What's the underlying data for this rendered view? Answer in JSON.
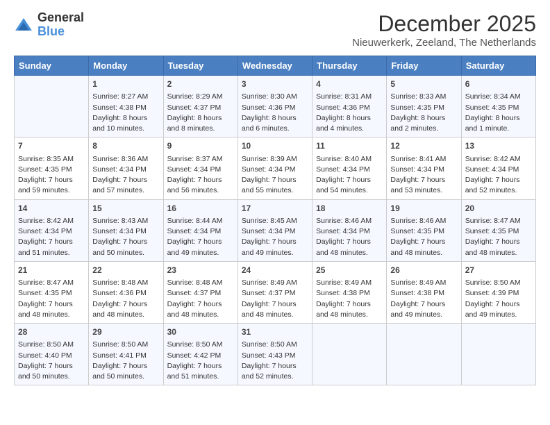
{
  "logo": {
    "general": "General",
    "blue": "Blue"
  },
  "title": "December 2025",
  "location": "Nieuwerkerk, Zeeland, The Netherlands",
  "weekdays": [
    "Sunday",
    "Monday",
    "Tuesday",
    "Wednesday",
    "Thursday",
    "Friday",
    "Saturday"
  ],
  "weeks": [
    [
      {
        "day": "",
        "info": ""
      },
      {
        "day": "1",
        "info": "Sunrise: 8:27 AM\nSunset: 4:38 PM\nDaylight: 8 hours\nand 10 minutes."
      },
      {
        "day": "2",
        "info": "Sunrise: 8:29 AM\nSunset: 4:37 PM\nDaylight: 8 hours\nand 8 minutes."
      },
      {
        "day": "3",
        "info": "Sunrise: 8:30 AM\nSunset: 4:36 PM\nDaylight: 8 hours\nand 6 minutes."
      },
      {
        "day": "4",
        "info": "Sunrise: 8:31 AM\nSunset: 4:36 PM\nDaylight: 8 hours\nand 4 minutes."
      },
      {
        "day": "5",
        "info": "Sunrise: 8:33 AM\nSunset: 4:35 PM\nDaylight: 8 hours\nand 2 minutes."
      },
      {
        "day": "6",
        "info": "Sunrise: 8:34 AM\nSunset: 4:35 PM\nDaylight: 8 hours\nand 1 minute."
      }
    ],
    [
      {
        "day": "7",
        "info": "Sunrise: 8:35 AM\nSunset: 4:35 PM\nDaylight: 7 hours\nand 59 minutes."
      },
      {
        "day": "8",
        "info": "Sunrise: 8:36 AM\nSunset: 4:34 PM\nDaylight: 7 hours\nand 57 minutes."
      },
      {
        "day": "9",
        "info": "Sunrise: 8:37 AM\nSunset: 4:34 PM\nDaylight: 7 hours\nand 56 minutes."
      },
      {
        "day": "10",
        "info": "Sunrise: 8:39 AM\nSunset: 4:34 PM\nDaylight: 7 hours\nand 55 minutes."
      },
      {
        "day": "11",
        "info": "Sunrise: 8:40 AM\nSunset: 4:34 PM\nDaylight: 7 hours\nand 54 minutes."
      },
      {
        "day": "12",
        "info": "Sunrise: 8:41 AM\nSunset: 4:34 PM\nDaylight: 7 hours\nand 53 minutes."
      },
      {
        "day": "13",
        "info": "Sunrise: 8:42 AM\nSunset: 4:34 PM\nDaylight: 7 hours\nand 52 minutes."
      }
    ],
    [
      {
        "day": "14",
        "info": "Sunrise: 8:42 AM\nSunset: 4:34 PM\nDaylight: 7 hours\nand 51 minutes."
      },
      {
        "day": "15",
        "info": "Sunrise: 8:43 AM\nSunset: 4:34 PM\nDaylight: 7 hours\nand 50 minutes."
      },
      {
        "day": "16",
        "info": "Sunrise: 8:44 AM\nSunset: 4:34 PM\nDaylight: 7 hours\nand 49 minutes."
      },
      {
        "day": "17",
        "info": "Sunrise: 8:45 AM\nSunset: 4:34 PM\nDaylight: 7 hours\nand 49 minutes."
      },
      {
        "day": "18",
        "info": "Sunrise: 8:46 AM\nSunset: 4:34 PM\nDaylight: 7 hours\nand 48 minutes."
      },
      {
        "day": "19",
        "info": "Sunrise: 8:46 AM\nSunset: 4:35 PM\nDaylight: 7 hours\nand 48 minutes."
      },
      {
        "day": "20",
        "info": "Sunrise: 8:47 AM\nSunset: 4:35 PM\nDaylight: 7 hours\nand 48 minutes."
      }
    ],
    [
      {
        "day": "21",
        "info": "Sunrise: 8:47 AM\nSunset: 4:35 PM\nDaylight: 7 hours\nand 48 minutes."
      },
      {
        "day": "22",
        "info": "Sunrise: 8:48 AM\nSunset: 4:36 PM\nDaylight: 7 hours\nand 48 minutes."
      },
      {
        "day": "23",
        "info": "Sunrise: 8:48 AM\nSunset: 4:37 PM\nDaylight: 7 hours\nand 48 minutes."
      },
      {
        "day": "24",
        "info": "Sunrise: 8:49 AM\nSunset: 4:37 PM\nDaylight: 7 hours\nand 48 minutes."
      },
      {
        "day": "25",
        "info": "Sunrise: 8:49 AM\nSunset: 4:38 PM\nDaylight: 7 hours\nand 48 minutes."
      },
      {
        "day": "26",
        "info": "Sunrise: 8:49 AM\nSunset: 4:38 PM\nDaylight: 7 hours\nand 49 minutes."
      },
      {
        "day": "27",
        "info": "Sunrise: 8:50 AM\nSunset: 4:39 PM\nDaylight: 7 hours\nand 49 minutes."
      }
    ],
    [
      {
        "day": "28",
        "info": "Sunrise: 8:50 AM\nSunset: 4:40 PM\nDaylight: 7 hours\nand 50 minutes."
      },
      {
        "day": "29",
        "info": "Sunrise: 8:50 AM\nSunset: 4:41 PM\nDaylight: 7 hours\nand 50 minutes."
      },
      {
        "day": "30",
        "info": "Sunrise: 8:50 AM\nSunset: 4:42 PM\nDaylight: 7 hours\nand 51 minutes."
      },
      {
        "day": "31",
        "info": "Sunrise: 8:50 AM\nSunset: 4:43 PM\nDaylight: 7 hours\nand 52 minutes."
      },
      {
        "day": "",
        "info": ""
      },
      {
        "day": "",
        "info": ""
      },
      {
        "day": "",
        "info": ""
      }
    ]
  ]
}
